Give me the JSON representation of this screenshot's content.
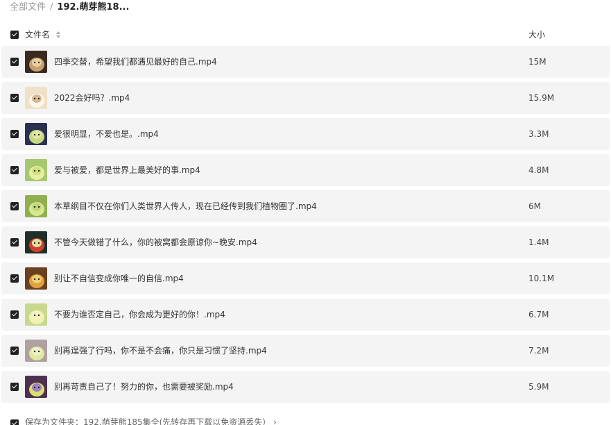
{
  "breadcrumb": {
    "root": "全部文件",
    "separator": "/",
    "current": "192.萌芽熊18..."
  },
  "header": {
    "name_label": "文件名",
    "size_label": "大小",
    "sort_icon": "sort-icon",
    "select_all_checked": true
  },
  "files": [
    {
      "name": "四季交替，希望我们都遇见最好的自己.mp4",
      "size": "15M",
      "checked": true
    },
    {
      "name": "2022会好吗？.mp4",
      "size": "15.9M",
      "checked": true
    },
    {
      "name": "爱很明显，不爱也是。.mp4",
      "size": "3.3M",
      "checked": true
    },
    {
      "name": "爱与被爱，都是世界上最美好的事.mp4",
      "size": "4.8M",
      "checked": true
    },
    {
      "name": "本草纲目不仅在你们人类世界人传人，现在已经传到我们植物圈了.mp4",
      "size": "6M",
      "checked": true
    },
    {
      "name": "不管今天做错了什么，你的被窝都会原谅你~晚安.mp4",
      "size": "1.4M",
      "checked": true
    },
    {
      "name": "别让不自信变成你唯一的自信.mp4",
      "size": "10.1M",
      "checked": true
    },
    {
      "name": "不要为谁否定自己，你会成为更好的你！.mp4",
      "size": "6.7M",
      "checked": true
    },
    {
      "name": "别再逞强了行吗，你不是不会痛，你只是习惯了坚持.mp4",
      "size": "7.2M",
      "checked": true
    },
    {
      "name": "别再苛责自己了！努力的你，也需要被奖励.mp4",
      "size": "5.9M",
      "checked": true
    }
  ],
  "footer": {
    "save_to_text": "保存为文件夹：192.萌芽熊185集全(先转存再下载以免资源丢失）  ›"
  },
  "colors": {
    "row_bg": "#f4f4f4",
    "checkbox": "#222222",
    "text": "#333333"
  }
}
